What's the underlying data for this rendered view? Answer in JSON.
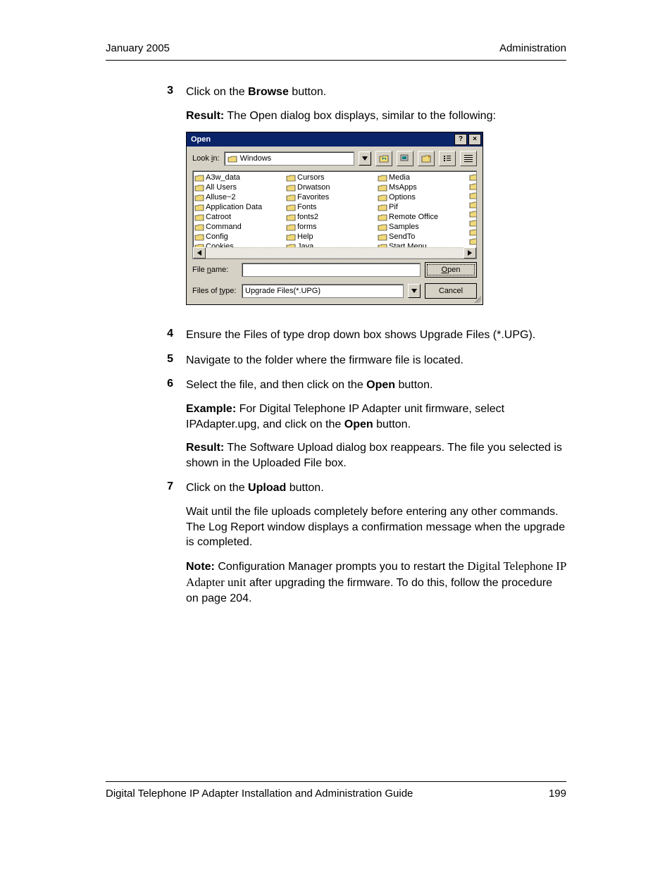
{
  "header": {
    "left": "January 2005",
    "right": "Administration"
  },
  "footer": {
    "title": "Digital Telephone IP Adapter Installation and Administration Guide",
    "page": "199"
  },
  "steps": {
    "3": {
      "a": "Click on the ",
      "b": "Browse",
      "c": " button.",
      "r1": "Result:",
      "r2": " The Open dialog box displays, similar to the following:"
    },
    "4": "Ensure the Files of type drop down box shows Upgrade Files (*.UPG).",
    "5": "Navigate to the folder where the firmware file is located.",
    "6": {
      "a": "Select the file, and then click on the ",
      "b": "Open",
      "c": " button.",
      "e1": "Example:",
      "e2": " For Digital Telephone IP Adapter unit firmware, select IPAdapter.upg, and click on the ",
      "e3": "Open",
      "e4": " button.",
      "r1": "Result:",
      "r2": " The Software Upload dialog box reappears. The file you selected is shown in the Uploaded File box."
    },
    "7": {
      "a": "Click on the ",
      "b": "Upload",
      "c": " button.",
      "p2": "Wait until the file uploads completely before entering any other commands. The Log Report window displays a confirmation message when the upgrade is completed.",
      "n1": "Note:",
      "n2": " Configuration Manager prompts you to restart the ",
      "n3": "Digital Telephone IP Adapter unit",
      "n4": " after upgrading the firmware. To do this, follow the procedure on page 204."
    }
  },
  "dialog": {
    "title": "Open",
    "lookin_label": "Look in:",
    "lookin_value": "Windows",
    "filename_label": "File name:",
    "filename_value": "",
    "filetype_label": "Files of type:",
    "filetype_value": "Upgrade Files(*.UPG)",
    "open_btn": "Open",
    "cancel_btn": "Cancel",
    "folders": {
      "c1": [
        "A3w_data",
        "All Users",
        "Alluse~2",
        "Application Data",
        "Catroot",
        "Command",
        "Config",
        "Cookies"
      ],
      "c2": [
        "Cursors",
        "Drwatson",
        "Favorites",
        "Fonts",
        "fonts2",
        "forms",
        "Help",
        "Java"
      ],
      "c3": [
        "Media",
        "MsApps",
        "Options",
        "Pif",
        "Remote Office",
        "Samples",
        "SendTo",
        "Start Menu"
      ]
    }
  }
}
